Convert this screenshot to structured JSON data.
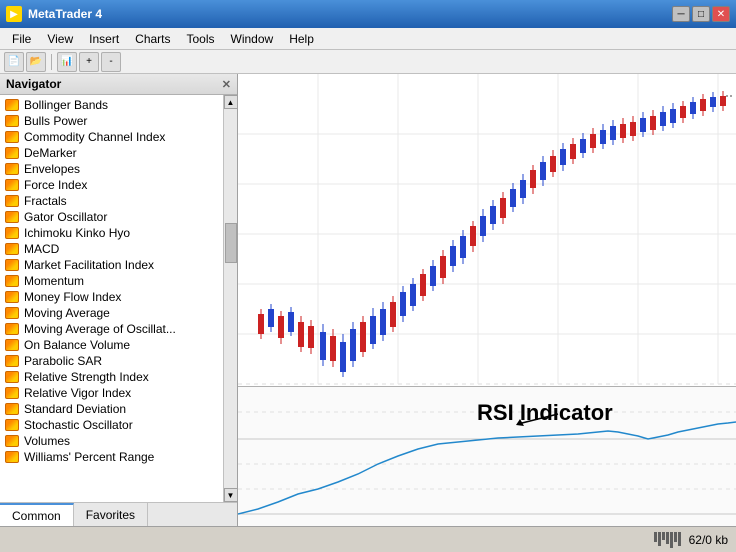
{
  "titleBar": {
    "title": "MetaTrader 4",
    "controls": {
      "minimize": "─",
      "maximize": "□",
      "close": "✕"
    }
  },
  "menuBar": {
    "items": [
      "File",
      "View",
      "Insert",
      "Charts",
      "Tools",
      "Window",
      "Help"
    ]
  },
  "navigator": {
    "title": "Navigator",
    "indicators": [
      "Bollinger Bands",
      "Bulls Power",
      "Commodity Channel Index",
      "DeMarker",
      "Envelopes",
      "Force Index",
      "Fractals",
      "Gator Oscillator",
      "Ichimoku Kinko Hyo",
      "MACD",
      "Market Facilitation Index",
      "Momentum",
      "Money Flow Index",
      "Moving Average",
      "Moving Average of Oscillat...",
      "On Balance Volume",
      "Parabolic SAR",
      "Relative Strength Index",
      "Relative Vigor Index",
      "Standard Deviation",
      "Stochastic Oscillator",
      "Volumes",
      "Williams' Percent Range"
    ],
    "tabs": [
      "Common",
      "Favorites"
    ]
  },
  "chart": {
    "rsiLabel": "RSI Indicator"
  },
  "statusBar": {
    "memory": "62/0 kb"
  }
}
